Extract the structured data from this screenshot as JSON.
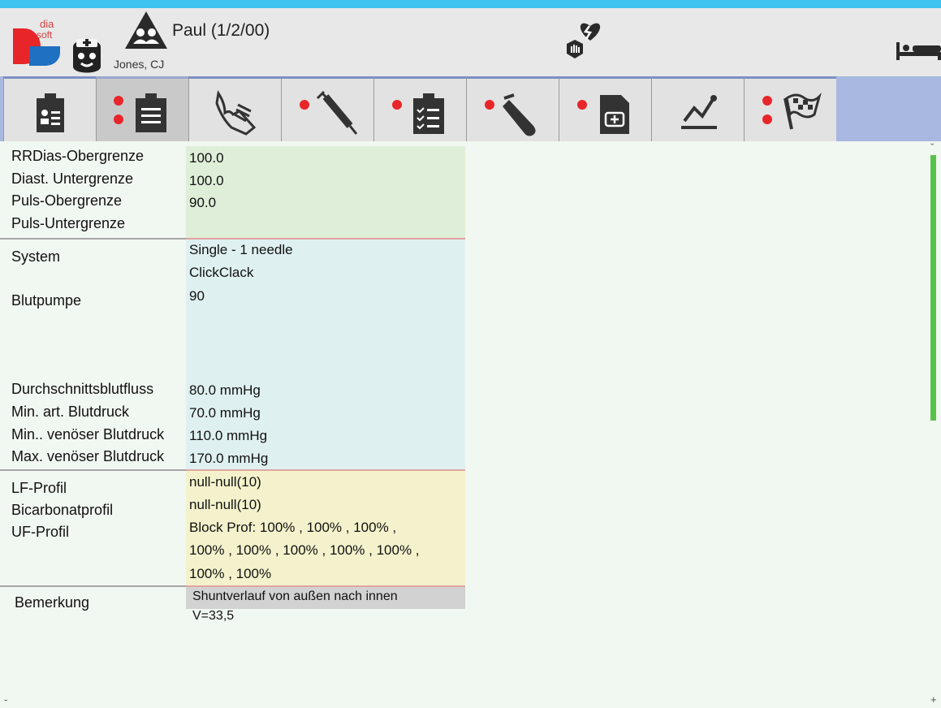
{
  "header": {
    "logo_text_top": "dia",
    "logo_text_bottom": "soft",
    "patient_name": "Paul (1/2/00)",
    "nurse_name": "Jones, CJ",
    "icons": [
      "diasoft-logo",
      "nurse-icon",
      "patient-icon",
      "heart-alert-icon",
      "bed-icon"
    ]
  },
  "tabs": [
    {
      "name": "patient-record",
      "dots": 0,
      "active": false
    },
    {
      "name": "clipboard",
      "dots": 2,
      "active": true
    },
    {
      "name": "hand",
      "dots": 0,
      "active": false
    },
    {
      "name": "syringe",
      "dots": 1,
      "active": false
    },
    {
      "name": "checklist",
      "dots": 1,
      "active": false
    },
    {
      "name": "test-tube",
      "dots": 1,
      "active": false
    },
    {
      "name": "medical-doc",
      "dots": 1,
      "active": false
    },
    {
      "name": "chart",
      "dots": 0,
      "active": false
    },
    {
      "name": "finish-flag",
      "dots": 2,
      "active": false
    }
  ],
  "sections": {
    "limits": {
      "labels": [
        "RRDias-Obergrenze",
        "Diast. Untergrenze",
        "Puls-Obergrenze",
        "Puls-Untergrenze"
      ],
      "values": [
        "100.0",
        "100.0",
        "90.0",
        ""
      ]
    },
    "system": {
      "system_label": "System",
      "system_values": [
        "Single - 1 needle",
        "ClickClack"
      ],
      "pump_label": "Blutpumpe",
      "pump_value": "90",
      "labels": [
        "Durchschnittsblutfluss",
        "Min. art. Blutdruck",
        "Min.. venöser Blutdruck",
        "Max. venöser Blutdruck"
      ],
      "values": [
        "80.0 mmHg",
        "70.0 mmHg",
        "110.0 mmHg",
        "170.0 mmHg"
      ]
    },
    "profiles": {
      "labels": [
        "LF-Profil",
        "Bicarbonatprofil",
        "UF-Profil"
      ],
      "values": [
        "null-null(10)",
        "null-null(10)",
        "Block Prof: 100% , 100% , 100% ,",
        "100% , 100% , 100% , 100% , 100% ,",
        "100% , 100%"
      ]
    },
    "remark": {
      "label": "Bemerkung",
      "line1": "Shuntverlauf von außen nach innen",
      "line2": "V=33,5"
    }
  },
  "colors": {
    "top_strip": "#3fc3f0",
    "limits_bg": "#dfeed8",
    "system_bg": "#dff0f0",
    "profiles_bg": "#f3f2cc",
    "remark_bg": "#d2d2d2",
    "tab_dot": "#e8262a",
    "scroll": "#59c24a"
  },
  "misc": {
    "scroll_top_marker": "ˇ",
    "minus_marker": "-",
    "plus_marker": "+"
  }
}
